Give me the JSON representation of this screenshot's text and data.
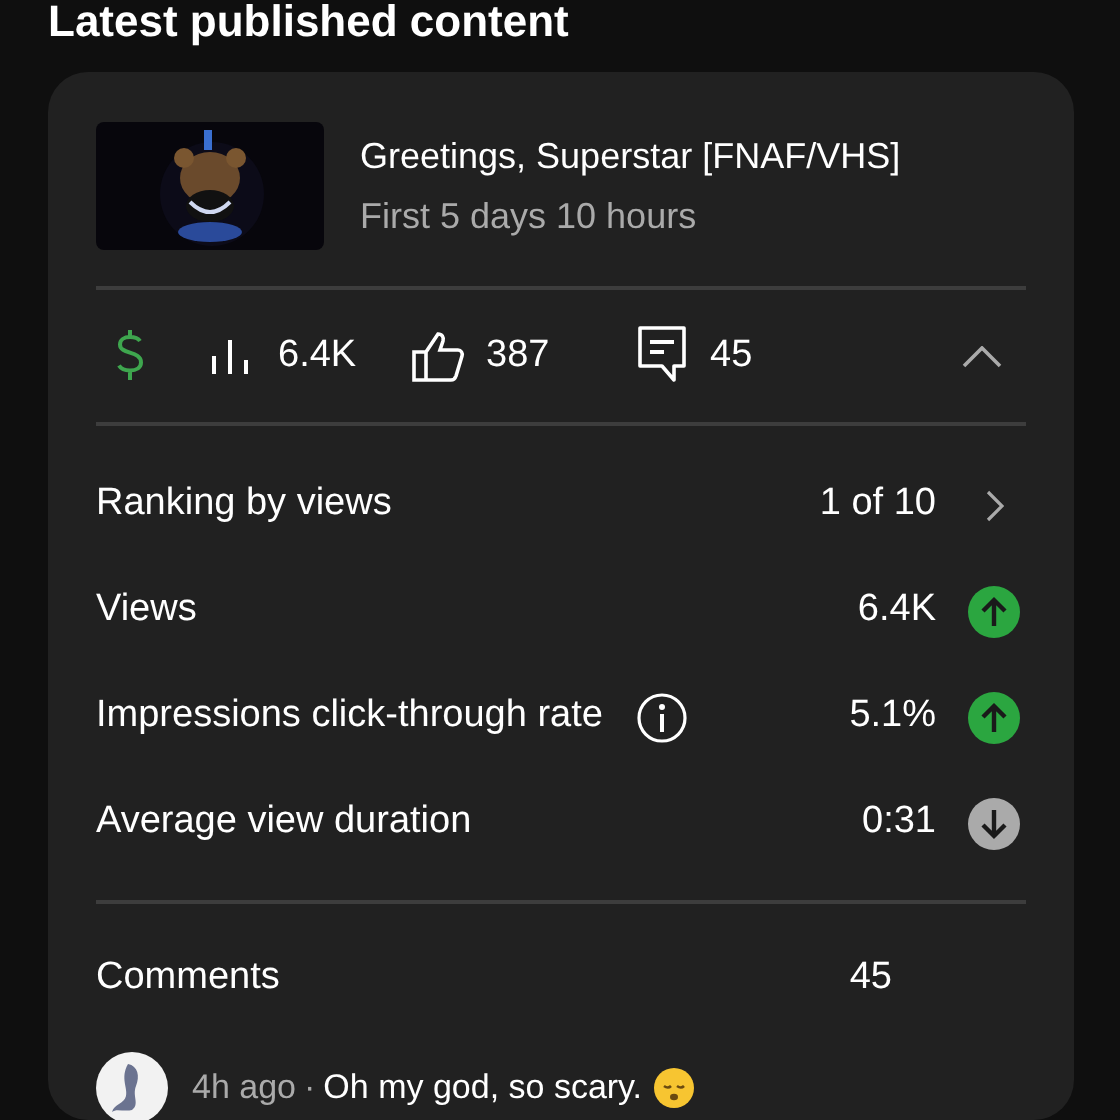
{
  "section": {
    "title": "Latest published content"
  },
  "video": {
    "title": "Greetings, Superstar [FNAF/VHS]",
    "period": "First 5 days 10 hours"
  },
  "stats": {
    "views": "6.4K",
    "likes": "387",
    "comments": "45",
    "expanded": true
  },
  "metrics": [
    {
      "kind": "link",
      "label": "Ranking by views",
      "value": "1 of 10",
      "info": false
    },
    {
      "kind": "trend",
      "label": "Views",
      "value": "6.4K",
      "rising": true,
      "info": false
    },
    {
      "kind": "trend",
      "label": "Impressions click-through rate",
      "value": "5.1%",
      "rising": true,
      "info": true
    },
    {
      "kind": "trend",
      "label": "Average view duration",
      "value": "0:31",
      "rising": false,
      "info": false
    }
  ],
  "comments": {
    "label": "Comments",
    "count": "45",
    "latest": {
      "time": "4h ago",
      "separator": "·",
      "text": "Oh my god, so scary."
    }
  }
}
